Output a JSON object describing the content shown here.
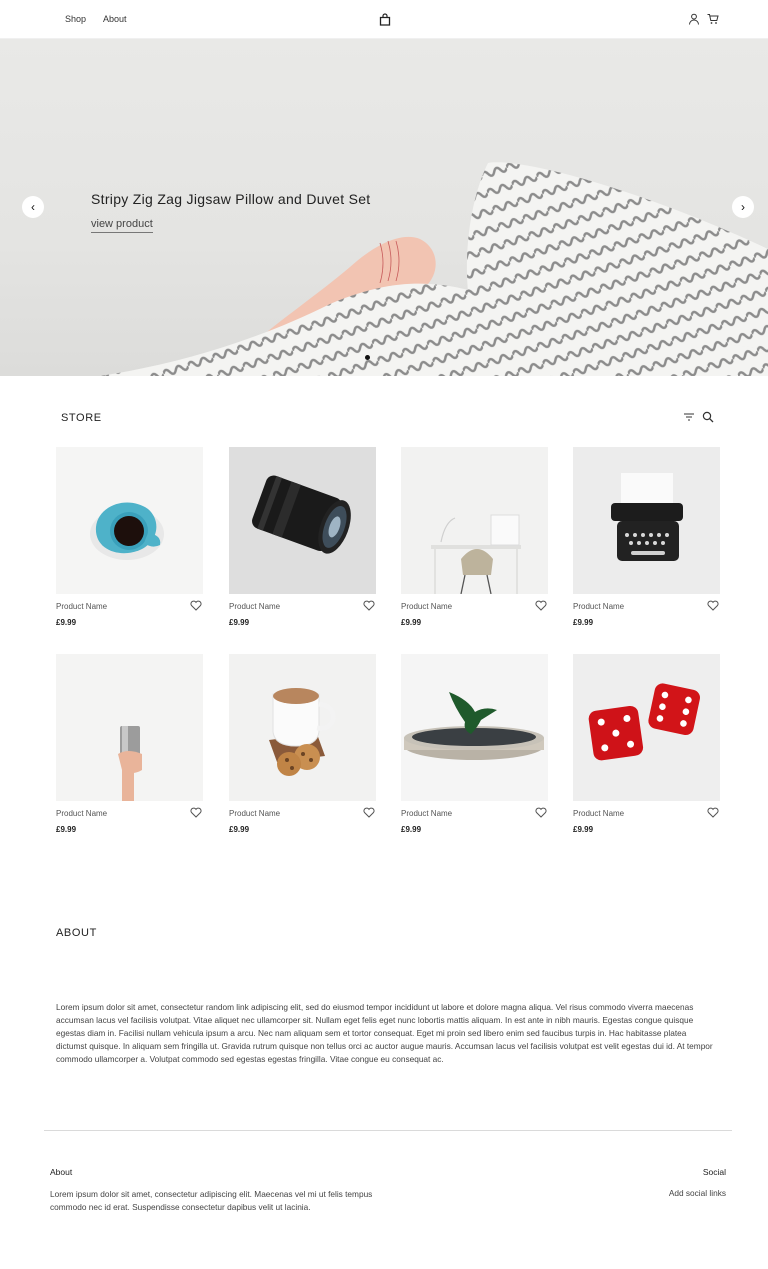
{
  "header": {
    "nav": [
      {
        "label": "Shop"
      },
      {
        "label": "About"
      }
    ],
    "logo_icon": "shopping-bag-icon",
    "account_icon": "user-icon",
    "cart_icon": "cart-icon"
  },
  "hero": {
    "title": "Stripy Zig Zag Jigsaw Pillow and Duvet Set",
    "link": "view product",
    "prev": "‹",
    "next": "›",
    "slide_count": 1,
    "active_slide": 1
  },
  "store": {
    "title": "STORE",
    "filter_icon": "filter-icon",
    "search_icon": "search-icon",
    "products": [
      {
        "name": "Product Name",
        "price": "£9.99",
        "image": "coffee-cup"
      },
      {
        "name": "Product Name",
        "price": "£9.99",
        "image": "camera-lens"
      },
      {
        "name": "Product Name",
        "price": "£9.99",
        "image": "desk-chair"
      },
      {
        "name": "Product Name",
        "price": "£9.99",
        "image": "typewriter"
      },
      {
        "name": "Product Name",
        "price": "£9.99",
        "image": "hand-cup"
      },
      {
        "name": "Product Name",
        "price": "£9.99",
        "image": "tea-cookies"
      },
      {
        "name": "Product Name",
        "price": "£9.99",
        "image": "spinning-top"
      },
      {
        "name": "Product Name",
        "price": "£9.99",
        "image": "red-dice"
      }
    ]
  },
  "about": {
    "title": "ABOUT",
    "text": "Lorem ipsum dolor sit amet, consectetur random link adipiscing elit, sed do eiusmod tempor incididunt ut labore et dolore magna aliqua. Vel risus commodo viverra maecenas accumsan lacus vel facilisis volutpat. Vitae aliquet nec ullamcorper sit. Nullam eget felis eget nunc lobortis mattis aliquam. In est ante in nibh mauris. Egestas congue quisque egestas diam in. Facilisi nullam vehicula ipsum a arcu. Nec nam aliquam sem et tortor consequat. Eget mi proin sed libero enim sed faucibus turpis in. Hac habitasse platea dictumst quisque. In aliquam sem fringilla ut. Gravida rutrum quisque non tellus orci ac auctor augue mauris. Accumsan lacus vel facilisis volutpat est velit egestas dui id. At tempor commodo ullamcorper a. Volutpat commodo sed egestas egestas fringilla. Vitae congue eu consequat ac."
  },
  "footer": {
    "about_heading": "About",
    "about_text": "Lorem ipsum dolor sit amet, consectetur adipiscing elit. Maecenas vel mi ut felis tempus commodo nec id erat. Suspendisse consectetur dapibus velit ut lacinia.",
    "social_heading": "Social",
    "social_text": "Add social links"
  }
}
